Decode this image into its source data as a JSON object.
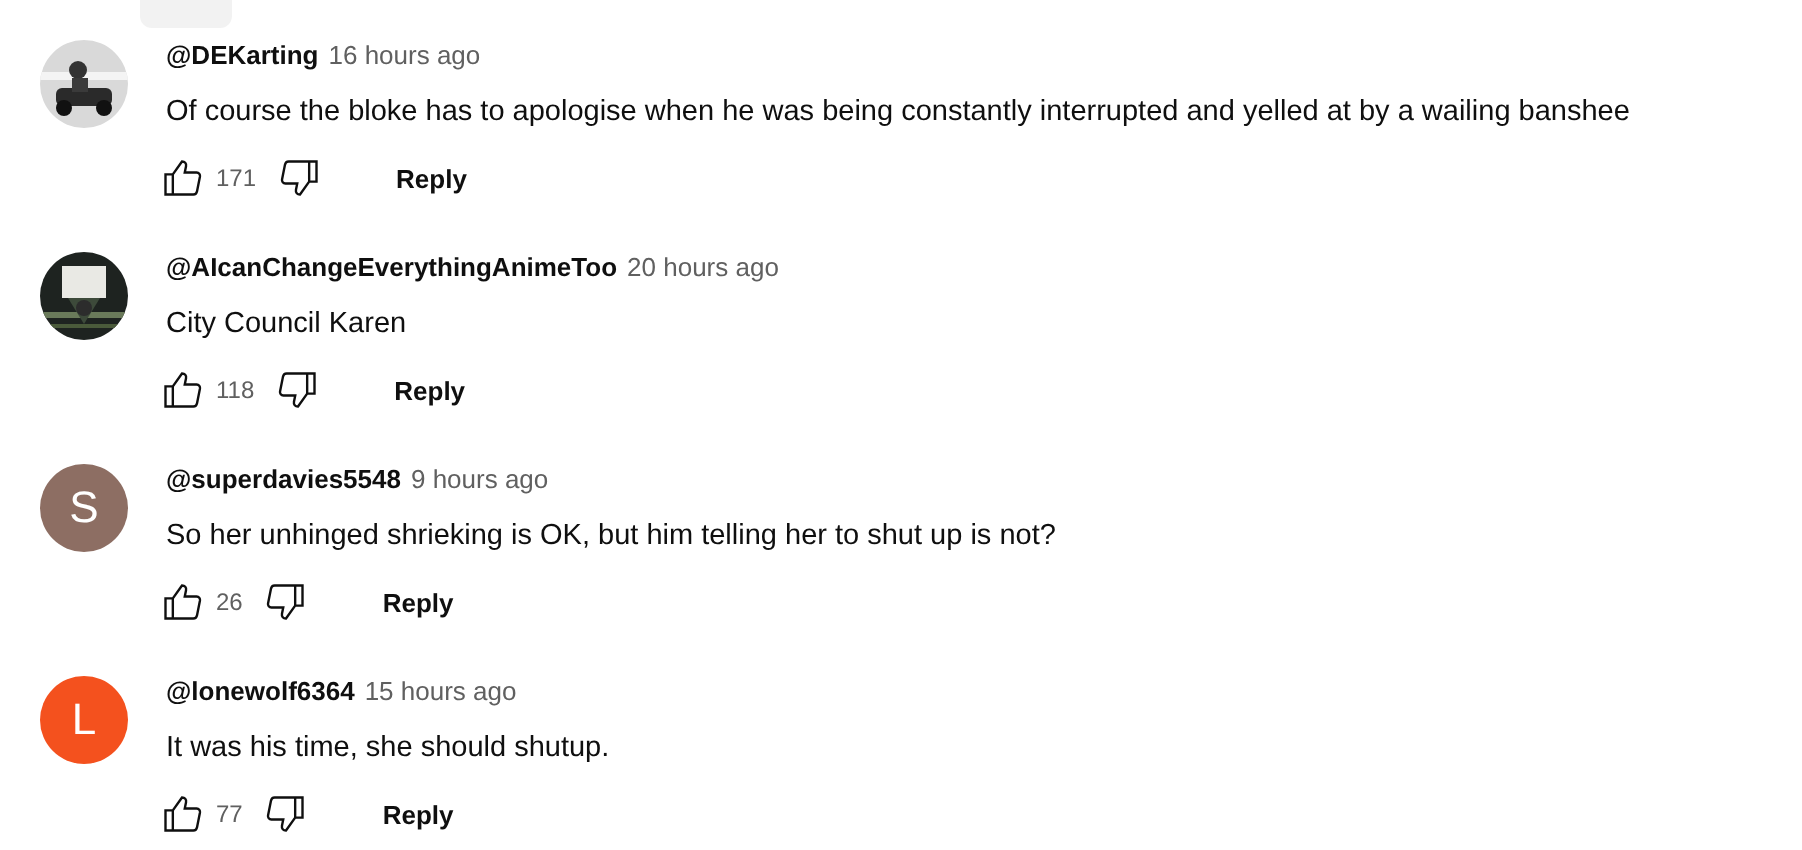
{
  "comments": [
    {
      "author": "@DEKarting",
      "time": "16 hours ago",
      "text": "Of course the bloke has to apologise when he was being constantly interrupted and yelled at by a wailing banshee",
      "likes": "171",
      "reply": "Reply"
    },
    {
      "author": "@AIcanChangeEverythingAnimeToo",
      "time": "20 hours ago",
      "text": "City Council Karen",
      "likes": "118",
      "reply": "Reply"
    },
    {
      "avatar": {
        "kind": "letter",
        "letter": "S",
        "color": "#8d6e63"
      },
      "author": "@superdavies5548",
      "time": "9 hours ago",
      "text": "So her unhinged shrieking is OK, but him telling her to shut up is not?",
      "likes": "26",
      "reply": "Reply"
    },
    {
      "avatar": {
        "kind": "letter",
        "letter": "L",
        "color": "#f4511e"
      },
      "author": "@lonewolf6364",
      "time": "15 hours ago",
      "text": "It was his time, she should shutup.",
      "likes": "77",
      "reply": "Reply"
    }
  ]
}
